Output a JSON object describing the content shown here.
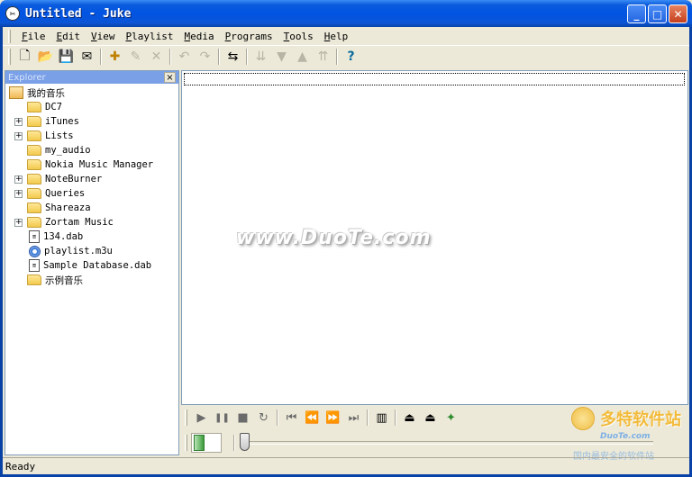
{
  "window": {
    "title": "Untitled - Juke",
    "minimize": "_",
    "maximize": "□",
    "close": "✕"
  },
  "menu": [
    {
      "mnemonic": "F",
      "rest": "ile"
    },
    {
      "mnemonic": "E",
      "rest": "dit"
    },
    {
      "mnemonic": "V",
      "rest": "iew"
    },
    {
      "mnemonic": "P",
      "rest": "laylist"
    },
    {
      "mnemonic": "M",
      "rest": "edia"
    },
    {
      "mnemonic": "P",
      "rest": "rograms"
    },
    {
      "mnemonic": "T",
      "rest": "ools"
    },
    {
      "mnemonic": "H",
      "rest": "elp"
    }
  ],
  "toolbar": {
    "new": "🗋",
    "open": "📂",
    "save": "💾",
    "email": "✉",
    "add": "✚",
    "edit": "✎",
    "remove": "✕",
    "undo": "↶",
    "redo": "↷",
    "shuffle": "⇆",
    "move_bottom": "⇊",
    "move_down": "▼",
    "move_up": "▲",
    "move_top": "⇈",
    "help": "?"
  },
  "explorer": {
    "title": "Explorer",
    "close": "×",
    "root": "我的音乐",
    "items": [
      {
        "label": "DC7",
        "icon": "folder-icon",
        "expandable": false
      },
      {
        "label": "iTunes",
        "icon": "folder-icon",
        "expandable": true
      },
      {
        "label": "Lists",
        "icon": "folder-icon",
        "expandable": true
      },
      {
        "label": "my_audio",
        "icon": "folder-icon",
        "expandable": false
      },
      {
        "label": "Nokia Music Manager",
        "icon": "folder-icon",
        "expandable": false
      },
      {
        "label": "NoteBurner",
        "icon": "folder-icon",
        "expandable": true
      },
      {
        "label": "Queries",
        "icon": "folder-icon",
        "expandable": true
      },
      {
        "label": "Shareaza",
        "icon": "folder-icon",
        "expandable": false
      },
      {
        "label": "Zortam Music",
        "icon": "folder-icon",
        "expandable": true
      },
      {
        "label": "134.dab",
        "icon": "database-file-icon",
        "expandable": false
      },
      {
        "label": "playlist.m3u",
        "icon": "playlist-cd-icon",
        "expandable": false
      },
      {
        "label": "Sample Database.dab",
        "icon": "database-file-icon",
        "expandable": false
      },
      {
        "label": "示例音乐",
        "icon": "folder-icon",
        "expandable": false
      }
    ]
  },
  "player": {
    "play": "▶",
    "pause": "❚❚",
    "stop": "■",
    "repeat": "↻",
    "first": "⏮",
    "prev": "⏪",
    "next": "⏩",
    "last": "⏭",
    "equalizer": "▥",
    "eject": "⏏",
    "burn": "⏏",
    "wizard": "✦"
  },
  "watermark": "www.DuoTe.com",
  "logo": {
    "name": "多特软件站",
    "site": "DuoTe.com",
    "slogan": "国内最安全的软件站"
  },
  "status": {
    "text": "Ready"
  },
  "colors": {
    "titlebar": "#0054e3",
    "face": "#ece9d8",
    "border": "#7f9db9",
    "highlight": "#7aa0e8"
  }
}
